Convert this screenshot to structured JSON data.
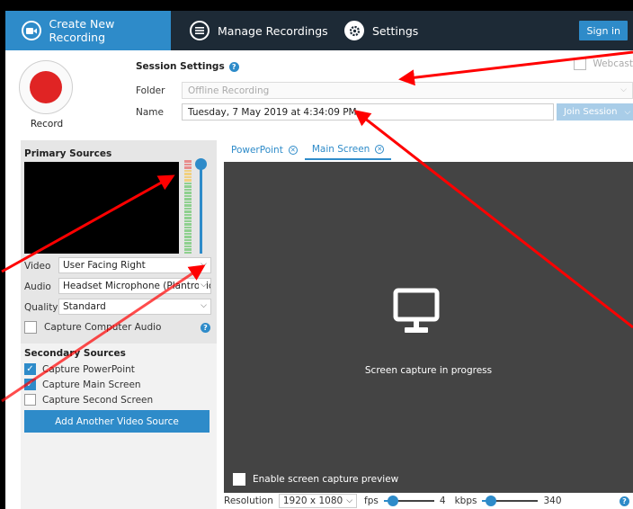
{
  "nav": {
    "create_label": "Create New Recording",
    "manage_label": "Manage Recordings",
    "settings_label": "Settings",
    "signin_label": "Sign in"
  },
  "session": {
    "record_label": "Record",
    "title": "Session Settings",
    "help_glyph": "?",
    "webcast_label": "Webcast",
    "folder_label": "Folder",
    "folder_value": "Offline Recording",
    "name_label": "Name",
    "name_value": "Tuesday, 7 May 2019 at 4:34:09 PM",
    "join_label": "Join Session"
  },
  "primary": {
    "title": "Primary Sources",
    "video_label": "Video",
    "video_value": "User Facing Right",
    "audio_label": "Audio",
    "audio_value": "Headset Microphone (Plantronics",
    "quality_label": "Quality",
    "quality_value": "Standard",
    "capture_audio_label": "Capture Computer Audio",
    "capture_audio_checked": false,
    "gain_level": 1.0
  },
  "secondary": {
    "title": "Secondary Sources",
    "items": [
      {
        "label": "Capture PowerPoint",
        "checked": true
      },
      {
        "label": "Capture Main Screen",
        "checked": true
      },
      {
        "label": "Capture Second Screen",
        "checked": false
      }
    ],
    "add_label": "Add Another Video Source"
  },
  "tabs": [
    {
      "label": "PowerPoint",
      "active": false
    },
    {
      "label": "Main Screen",
      "active": true
    }
  ],
  "capture": {
    "message": "Screen capture in progress",
    "preview_label": "Enable screen capture preview"
  },
  "bottom": {
    "resolution_label": "Resolution",
    "resolution_value": "1920 x 1080",
    "fps_label": "fps",
    "fps_value": "4",
    "kbps_label": "kbps",
    "kbps_value": "340"
  },
  "colors": {
    "accent": "#2e8bc9",
    "nav_bg": "#1d2a36",
    "record": "#e02424",
    "annotation_arrow": "#ff0000"
  },
  "icons": {
    "create": "video-camera-icon",
    "manage": "list-icon",
    "settings": "gear-icon",
    "capture": "monitor-icon"
  }
}
